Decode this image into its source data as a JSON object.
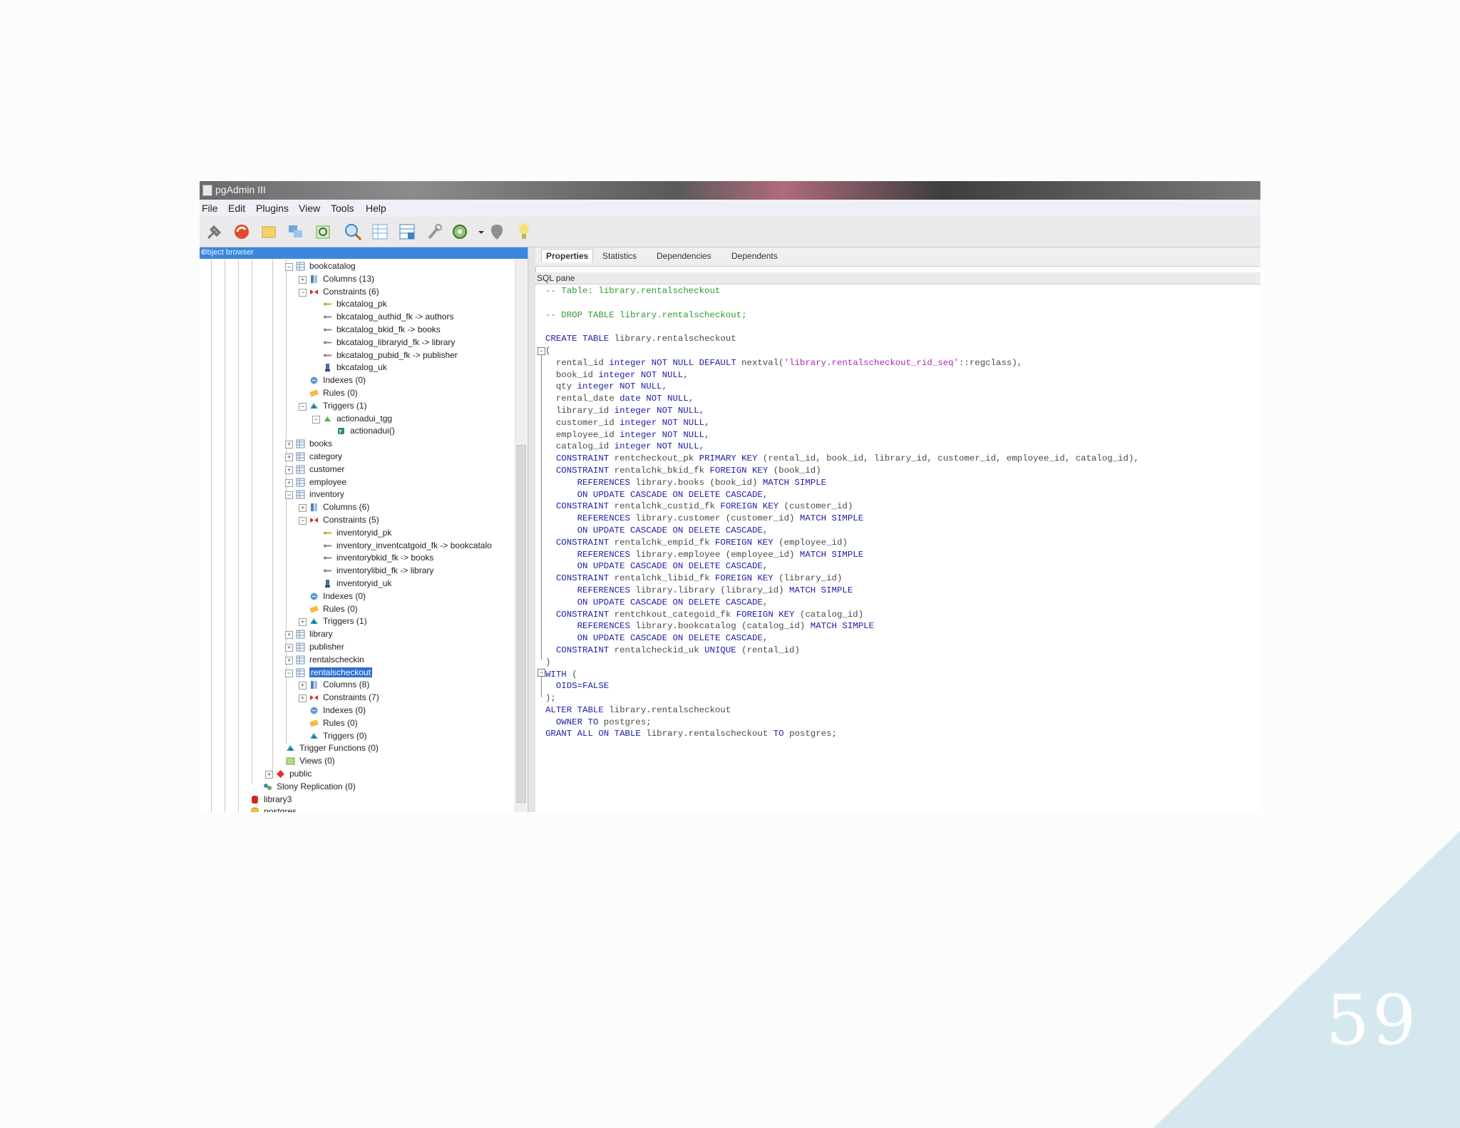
{
  "window": {
    "title": "pgAdmin III"
  },
  "menu": [
    "File",
    "Edit",
    "Plugins",
    "View",
    "Tools",
    "Help"
  ],
  "toolbar_icons": [
    "connect-icon",
    "refresh-icon",
    "properties-icon",
    "create-object-icon",
    "drop-object-icon",
    "sql-query-icon",
    "view-data-icon",
    "filtered-view-icon",
    "maintenance-icon",
    "plugins-icon",
    "dropdown-arrow-icon",
    "hint-icon",
    "help-icon"
  ],
  "object_browser": {
    "header": "Object browser",
    "close": "×",
    "tree": [
      {
        "label": "bookcatalog",
        "expander": "−",
        "icon": "table"
      },
      {
        "label": "Columns (13)",
        "expander": "+",
        "icon": "columns"
      },
      {
        "label": "Constraints (6)",
        "expander": "−",
        "icon": "constraints"
      },
      {
        "label": "bkcatalog_pk",
        "icon": "key"
      },
      {
        "label": "bkcatalog_authid_fk -> authors",
        "icon": "fk"
      },
      {
        "label": "bkcatalog_bkid_fk -> books",
        "icon": "fk"
      },
      {
        "label": "bkcatalog_libraryid_fk -> library",
        "icon": "fk"
      },
      {
        "label": "bkcatalog_pubid_fk -> publisher",
        "icon": "fk"
      },
      {
        "label": "bkcatalog_uk",
        "icon": "unique"
      },
      {
        "label": "Indexes (0)",
        "icon": "indexes"
      },
      {
        "label": "Rules (0)",
        "icon": "rules"
      },
      {
        "label": "Triggers (1)",
        "expander": "−",
        "icon": "triggers"
      },
      {
        "label": "actionadui_tgg",
        "expander": "−",
        "icon": "trigger"
      },
      {
        "label": "actionadui()",
        "icon": "function"
      },
      {
        "label": "books",
        "expander": "+",
        "icon": "table"
      },
      {
        "label": "category",
        "expander": "+",
        "icon": "table"
      },
      {
        "label": "customer",
        "expander": "+",
        "icon": "table"
      },
      {
        "label": "employee",
        "expander": "+",
        "icon": "table"
      },
      {
        "label": "inventory",
        "expander": "−",
        "icon": "table"
      },
      {
        "label": "Columns (6)",
        "expander": "+",
        "icon": "columns"
      },
      {
        "label": "Constraints (5)",
        "expander": "−",
        "icon": "constraints"
      },
      {
        "label": "inventoryid_pk",
        "icon": "key"
      },
      {
        "label": "inventory_inventcatgoid_fk -> bookcatalo",
        "icon": "fk"
      },
      {
        "label": "inventorybkid_fk -> books",
        "icon": "fk"
      },
      {
        "label": "inventorylibid_fk -> library",
        "icon": "fk"
      },
      {
        "label": "inventoryid_uk",
        "icon": "unique"
      },
      {
        "label": "Indexes (0)",
        "icon": "indexes"
      },
      {
        "label": "Rules (0)",
        "icon": "rules"
      },
      {
        "label": "Triggers (1)",
        "expander": "+",
        "icon": "triggers"
      },
      {
        "label": "library",
        "expander": "+",
        "icon": "table"
      },
      {
        "label": "publisher",
        "expander": "+",
        "icon": "table"
      },
      {
        "label": "rentalscheckin",
        "expander": "+",
        "icon": "table"
      },
      {
        "label": "rentalscheckout",
        "expander": "−",
        "icon": "table",
        "selected": true
      },
      {
        "label": "Columns (8)",
        "expander": "+",
        "icon": "columns"
      },
      {
        "label": "Constraints (7)",
        "expander": "+",
        "icon": "constraints"
      },
      {
        "label": "Indexes (0)",
        "icon": "indexes"
      },
      {
        "label": "Rules (0)",
        "icon": "rules"
      },
      {
        "label": "Triggers (0)",
        "icon": "triggers"
      },
      {
        "label": "Trigger Functions (0)",
        "icon": "triggers"
      },
      {
        "label": "Views (0)",
        "icon": "views"
      },
      {
        "label": "public",
        "expander": "+",
        "icon": "schema"
      },
      {
        "label": "Slony Replication (0)",
        "icon": "slony"
      },
      {
        "label": "library3",
        "icon": "database-red"
      },
      {
        "label": "postgres",
        "icon": "database"
      }
    ]
  },
  "tabs": [
    "Properties",
    "Statistics",
    "Dependencies",
    "Dependents"
  ],
  "active_tab": "Properties",
  "sql_pane": {
    "header": "SQL pane",
    "lines": [
      [
        [
          "cm",
          "-- Table: library.rentalscheckout"
        ]
      ],
      [
        [
          "",
          ""
        ]
      ],
      [
        [
          "cm",
          "-- DROP TABLE library.rentalscheckout;"
        ]
      ],
      [
        [
          "",
          ""
        ]
      ],
      [
        [
          "kw",
          "CREATE TABLE "
        ],
        [
          "",
          "library.rentalscheckout"
        ]
      ],
      [
        [
          "",
          "("
        ]
      ],
      [
        [
          "",
          "  rental_id "
        ],
        [
          "kw",
          "integer NOT NULL DEFAULT "
        ],
        [
          "",
          "nextval("
        ],
        [
          "st",
          "'library.rentalscheckout_rid_seq'"
        ],
        [
          "",
          "::regclass),"
        ]
      ],
      [
        [
          "",
          "  book_id "
        ],
        [
          "kw",
          "integer NOT NULL"
        ],
        [
          "",
          ","
        ]
      ],
      [
        [
          "",
          "  qty "
        ],
        [
          "kw",
          "integer NOT NULL"
        ],
        [
          "",
          ","
        ]
      ],
      [
        [
          "",
          "  rental_date "
        ],
        [
          "kw",
          "date NOT NULL"
        ],
        [
          "",
          ","
        ]
      ],
      [
        [
          "",
          "  library_id "
        ],
        [
          "kw",
          "integer NOT NULL"
        ],
        [
          "",
          ","
        ]
      ],
      [
        [
          "",
          "  customer_id "
        ],
        [
          "kw",
          "integer NOT NULL"
        ],
        [
          "",
          ","
        ]
      ],
      [
        [
          "",
          "  employee_id "
        ],
        [
          "kw",
          "integer NOT NULL"
        ],
        [
          "",
          ","
        ]
      ],
      [
        [
          "",
          "  catalog_id "
        ],
        [
          "kw",
          "integer NOT NULL"
        ],
        [
          "",
          ","
        ]
      ],
      [
        [
          "kw",
          "  CONSTRAINT "
        ],
        [
          "",
          "rentcheckout_pk "
        ],
        [
          "kw",
          "PRIMARY KEY "
        ],
        [
          "",
          "(rental_id, book_id, library_id, customer_id, employee_id, catalog_id),"
        ]
      ],
      [
        [
          "kw",
          "  CONSTRAINT "
        ],
        [
          "",
          "rentalchk_bkid_fk "
        ],
        [
          "kw",
          "FOREIGN KEY "
        ],
        [
          "",
          "(book_id)"
        ]
      ],
      [
        [
          "kw",
          "      REFERENCES "
        ],
        [
          "",
          "library.books (book_id) "
        ],
        [
          "kw",
          "MATCH SIMPLE"
        ]
      ],
      [
        [
          "kw",
          "      ON UPDATE CASCADE ON DELETE CASCADE"
        ],
        [
          "",
          ","
        ]
      ],
      [
        [
          "kw",
          "  CONSTRAINT "
        ],
        [
          "",
          "rentalchk_custid_fk "
        ],
        [
          "kw",
          "FOREIGN KEY "
        ],
        [
          "",
          "(customer_id)"
        ]
      ],
      [
        [
          "kw",
          "      REFERENCES "
        ],
        [
          "",
          "library.customer (customer_id) "
        ],
        [
          "kw",
          "MATCH SIMPLE"
        ]
      ],
      [
        [
          "kw",
          "      ON UPDATE CASCADE ON DELETE CASCADE"
        ],
        [
          "",
          ","
        ]
      ],
      [
        [
          "kw",
          "  CONSTRAINT "
        ],
        [
          "",
          "rentalchk_empid_fk "
        ],
        [
          "kw",
          "FOREIGN KEY "
        ],
        [
          "",
          "(employee_id)"
        ]
      ],
      [
        [
          "kw",
          "      REFERENCES "
        ],
        [
          "",
          "library.employee (employee_id) "
        ],
        [
          "kw",
          "MATCH SIMPLE"
        ]
      ],
      [
        [
          "kw",
          "      ON UPDATE CASCADE ON DELETE CASCADE"
        ],
        [
          "",
          ","
        ]
      ],
      [
        [
          "kw",
          "  CONSTRAINT "
        ],
        [
          "",
          "rentalchk_libid_fk "
        ],
        [
          "kw",
          "FOREIGN KEY "
        ],
        [
          "",
          "(library_id)"
        ]
      ],
      [
        [
          "kw",
          "      REFERENCES "
        ],
        [
          "",
          "library.library (library_id) "
        ],
        [
          "kw",
          "MATCH SIMPLE"
        ]
      ],
      [
        [
          "kw",
          "      ON UPDATE CASCADE ON DELETE CASCADE"
        ],
        [
          "",
          ","
        ]
      ],
      [
        [
          "kw",
          "  CONSTRAINT "
        ],
        [
          "",
          "rentchkout_categoid_fk "
        ],
        [
          "kw",
          "FOREIGN KEY "
        ],
        [
          "",
          "(catalog_id)"
        ]
      ],
      [
        [
          "kw",
          "      REFERENCES "
        ],
        [
          "",
          "library.bookcatalog (catalog_id) "
        ],
        [
          "kw",
          "MATCH SIMPLE"
        ]
      ],
      [
        [
          "kw",
          "      ON UPDATE CASCADE ON DELETE CASCADE"
        ],
        [
          "",
          ","
        ]
      ],
      [
        [
          "kw",
          "  CONSTRAINT "
        ],
        [
          "",
          "rentalcheckid_uk "
        ],
        [
          "kw",
          "UNIQUE "
        ],
        [
          "",
          "(rental_id)"
        ]
      ],
      [
        [
          "",
          ")"
        ]
      ],
      [
        [
          "kw",
          "WITH "
        ],
        [
          "",
          "("
        ]
      ],
      [
        [
          "kw",
          "  OIDS=FALSE"
        ]
      ],
      [
        [
          "",
          ");"
        ]
      ],
      [
        [
          "kw",
          "ALTER TABLE "
        ],
        [
          "",
          "library.rentalscheckout"
        ]
      ],
      [
        [
          "kw",
          "  OWNER TO "
        ],
        [
          "",
          "postgres;"
        ]
      ],
      [
        [
          "kw",
          "GRANT ALL ON TABLE "
        ],
        [
          "",
          "library.rentalscheckout "
        ],
        [
          "kw",
          "TO "
        ],
        [
          "",
          "postgres;"
        ]
      ]
    ]
  },
  "slide_number": "59",
  "colors": {
    "accent_triangle": "#d5e8ef",
    "selection": "#2d6fd6",
    "keyword": "#2020a8",
    "comment": "#2e9a2e",
    "string": "#b02ab0"
  }
}
